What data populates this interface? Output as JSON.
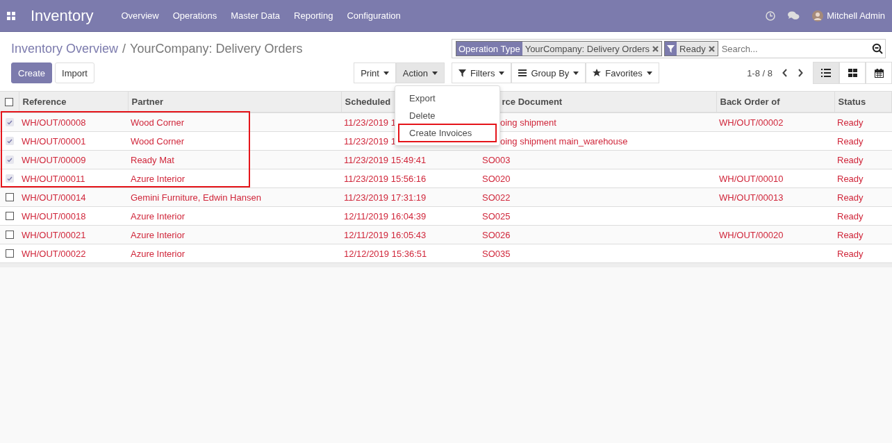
{
  "navbar": {
    "app_title": "Inventory",
    "menu": [
      "Overview",
      "Operations",
      "Master Data",
      "Reporting",
      "Configuration"
    ],
    "user": "Mitchell Admin"
  },
  "breadcrumb": {
    "parent": "Inventory Overview",
    "separator": "/",
    "current": "YourCompany: Delivery Orders"
  },
  "search": {
    "facets": [
      {
        "kind": "field",
        "label": "Operation Type",
        "value": "YourCompany: Delivery Orders"
      },
      {
        "kind": "filter",
        "value": "Ready"
      }
    ],
    "placeholder": "Search..."
  },
  "buttons": [
    "Create",
    "Import"
  ],
  "sidebar_buttons": [
    {
      "label": "Print",
      "open": false
    },
    {
      "label": "Action",
      "open": true
    }
  ],
  "action_menu": [
    {
      "label": "Export",
      "annotated": false
    },
    {
      "label": "Delete",
      "annotated": false
    },
    {
      "label": "Create Invoices",
      "annotated": true
    }
  ],
  "search_options": [
    {
      "kind": "filter",
      "label": "Filters"
    },
    {
      "kind": "group",
      "label": "Group By"
    },
    {
      "kind": "star",
      "label": "Favorites"
    }
  ],
  "pager": "1-8 / 8",
  "views": [
    {
      "kind": "list",
      "selected": true
    },
    {
      "kind": "kanban",
      "selected": false
    },
    {
      "kind": "calendar",
      "selected": false
    }
  ],
  "table": {
    "all_checked": false,
    "columns": [
      "Reference",
      "Partner",
      "Scheduled",
      "rce Document",
      "Back Order of",
      "Status"
    ],
    "rows": [
      {
        "checked": true,
        "annotated": true,
        "cells": [
          "WH/OUT/00008",
          "Wood Corner",
          "11/23/2019 1",
          "oing shipment",
          "WH/OUT/00002",
          "Ready"
        ]
      },
      {
        "checked": true,
        "annotated": true,
        "cells": [
          "WH/OUT/00001",
          "Wood Corner",
          "11/23/2019 1",
          "oing shipment main_warehouse",
          "",
          "Ready"
        ]
      },
      {
        "checked": true,
        "annotated": true,
        "cells": [
          "WH/OUT/00009",
          "Ready Mat",
          "11/23/2019 15:49:41",
          "SO003",
          "",
          "Ready"
        ]
      },
      {
        "checked": true,
        "annotated": true,
        "cells": [
          "WH/OUT/00011",
          "Azure Interior",
          "11/23/2019 15:56:16",
          "SO020",
          "WH/OUT/00010",
          "Ready"
        ]
      },
      {
        "checked": false,
        "annotated": false,
        "cells": [
          "WH/OUT/00014",
          "Gemini Furniture, Edwin Hansen",
          "11/23/2019 17:31:19",
          "SO022",
          "WH/OUT/00013",
          "Ready"
        ]
      },
      {
        "checked": false,
        "annotated": false,
        "cells": [
          "WH/OUT/00018",
          "Azure Interior",
          "12/11/2019 16:04:39",
          "SO025",
          "",
          "Ready"
        ]
      },
      {
        "checked": false,
        "annotated": false,
        "cells": [
          "WH/OUT/00021",
          "Azure Interior",
          "12/11/2019 16:05:43",
          "SO026",
          "WH/OUT/00020",
          "Ready"
        ]
      },
      {
        "checked": false,
        "annotated": false,
        "cells": [
          "WH/OUT/00022",
          "Azure Interior",
          "12/12/2019 15:36:51",
          "SO035",
          "",
          "Ready"
        ]
      }
    ]
  }
}
